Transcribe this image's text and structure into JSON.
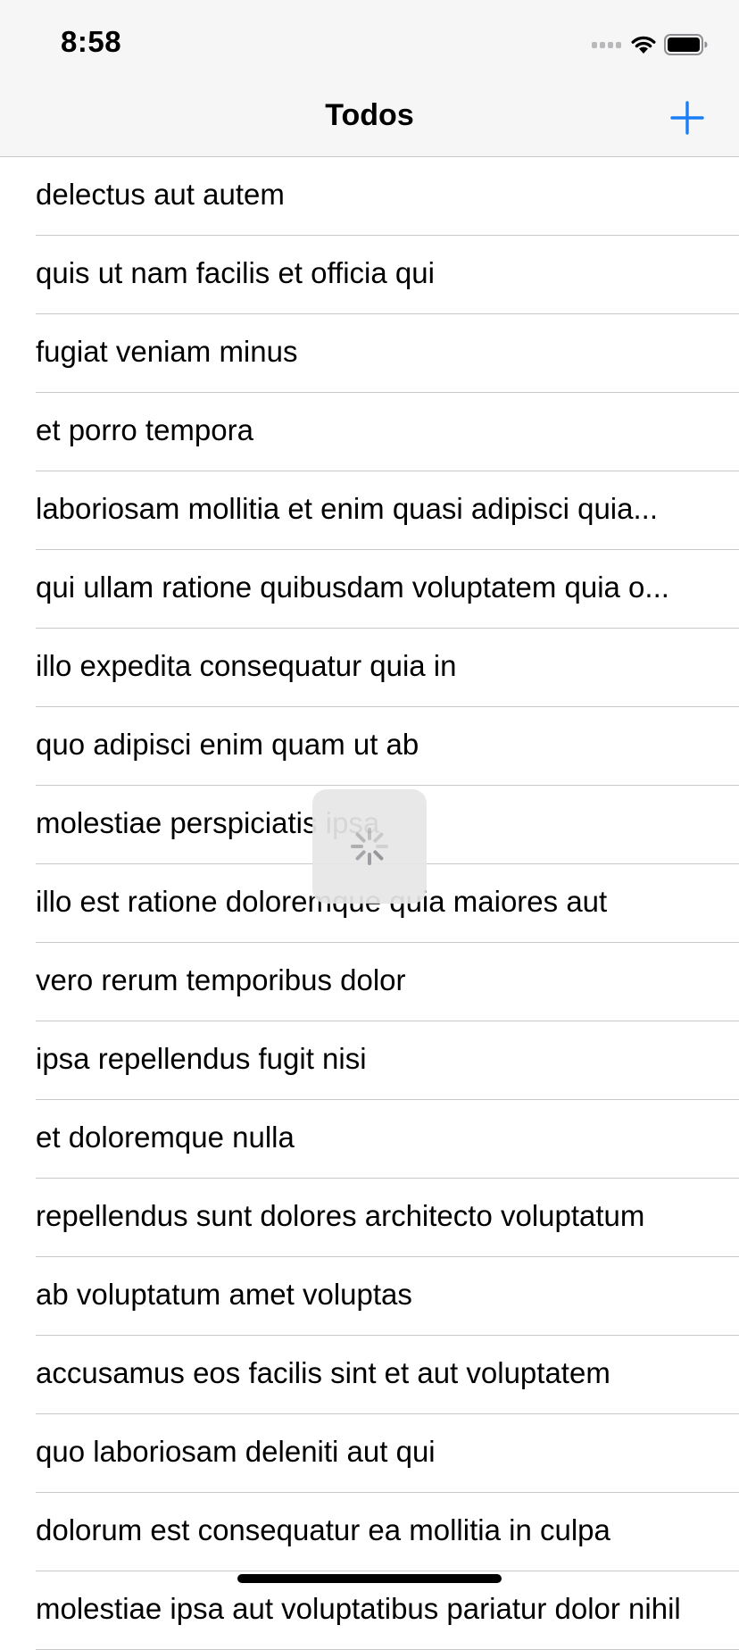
{
  "status_bar": {
    "time": "8:58"
  },
  "nav_bar": {
    "title": "Todos",
    "add_icon": "plus-icon",
    "accent_color": "#1a7ff5"
  },
  "todos": [
    "delectus aut autem",
    "quis ut nam facilis et officia qui",
    "fugiat veniam minus",
    "et porro tempora",
    "laboriosam mollitia et enim quasi adipisci quia...",
    "qui ullam ratione quibusdam voluptatem quia o...",
    "illo expedita consequatur quia in",
    "quo adipisci enim quam ut ab",
    "molestiae perspiciatis ipsa",
    "illo est ratione doloremque quia maiores aut",
    "vero rerum temporibus dolor",
    "ipsa repellendus fugit nisi",
    "et doloremque nulla",
    "repellendus sunt dolores architecto voluptatum",
    "ab voluptatum amet voluptas",
    "accusamus eos facilis sint et aut voluptatem",
    "quo laboriosam deleniti aut qui",
    "dolorum est consequatur ea mollitia in culpa",
    "molestiae ipsa aut voluptatibus pariatur dolor nihil"
  ],
  "loading_indicator": {
    "icon": "activity-spinner-icon"
  }
}
